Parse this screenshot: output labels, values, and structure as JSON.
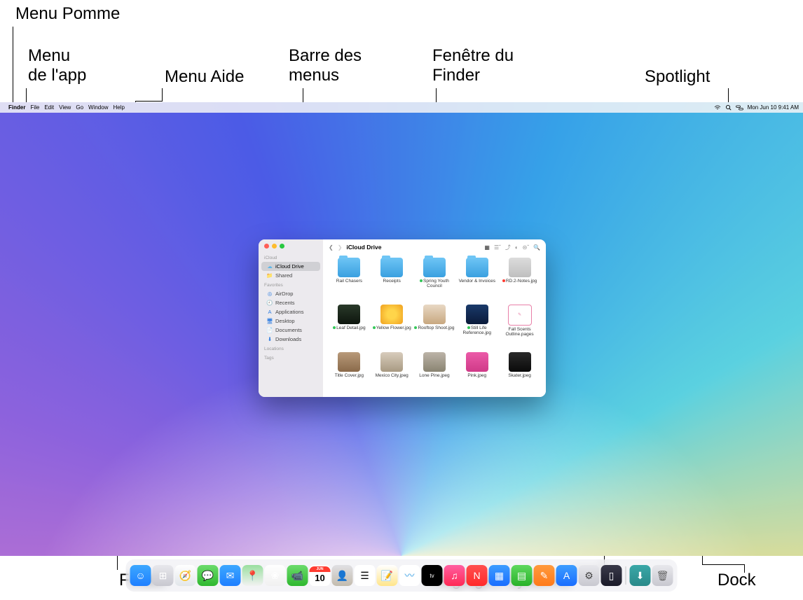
{
  "callouts": {
    "apple_menu": "Menu Pomme",
    "app_menu_1": "Menu",
    "app_menu_2": "de l'app",
    "help_menu": "Menu Aide",
    "menu_bar_1": "Barre des",
    "menu_bar_2": "menus",
    "finder_win_1": "Fenêtre du",
    "finder_win_2": "Finder",
    "spotlight": "Spotlight",
    "finder": "Finder",
    "system_settings": "Réglages Système",
    "dock": "Dock"
  },
  "menubar": {
    "items": [
      "Finder",
      "File",
      "Edit",
      "View",
      "Go",
      "Window",
      "Help"
    ],
    "status": {
      "wifi": "wifi",
      "spotlight": "search",
      "control": "control-center"
    },
    "clock": "Mon Jun 10  9:41 AM"
  },
  "finder": {
    "title": "iCloud Drive",
    "sidebar": {
      "sections": [
        {
          "label": "iCloud",
          "items": [
            {
              "icon": "cloud",
              "label": "iCloud Drive",
              "selected": true,
              "color": "#5cb6ea"
            },
            {
              "icon": "shared",
              "label": "Shared",
              "color": "#5cb6ea"
            }
          ]
        },
        {
          "label": "Favorites",
          "items": [
            {
              "icon": "airdrop",
              "label": "AirDrop",
              "color": "#2f7de0"
            },
            {
              "icon": "clock",
              "label": "Recents",
              "color": "#2f7de0"
            },
            {
              "icon": "apps",
              "label": "Applications",
              "color": "#2f7de0"
            },
            {
              "icon": "desktop",
              "label": "Desktop",
              "color": "#2f7de0"
            },
            {
              "icon": "doc",
              "label": "Documents",
              "color": "#2f7de0"
            },
            {
              "icon": "download",
              "label": "Downloads",
              "color": "#2f7de0"
            }
          ]
        },
        {
          "label": "Locations",
          "items": []
        },
        {
          "label": "Tags",
          "items": []
        }
      ]
    },
    "files": [
      {
        "name": "Rail Chasers",
        "type": "folder"
      },
      {
        "name": "Receipts",
        "type": "folder"
      },
      {
        "name": "Spring Youth Council",
        "type": "folder",
        "dot": "#34c759"
      },
      {
        "name": "Vendor & Invoices",
        "type": "folder"
      },
      {
        "name": "RD.2-Notes.jpg",
        "type": "img",
        "dot": "#ff3b30",
        "bg": "linear-gradient(#dcdcdc,#bfbfbf)"
      },
      {
        "name": "Leaf Detail.jpg",
        "type": "img",
        "dot": "#34c759",
        "bg": "linear-gradient(#2a3a2a,#0d150d)"
      },
      {
        "name": "Yellow Flower.jpg",
        "type": "img",
        "dot": "#34c759",
        "bg": "radial-gradient(circle,#ffd54a 30%,#f0a020)"
      },
      {
        "name": "Rooftop Shoot.jpg",
        "type": "img",
        "dot": "#34c759",
        "bg": "linear-gradient(#e8d8c4,#c8a880)"
      },
      {
        "name": "Still Life Reference.jpg",
        "type": "img",
        "dot": "#34c759",
        "bg": "linear-gradient(#1a3a6a,#0a1a3a)"
      },
      {
        "name": "Fall Scents Outline.pages",
        "type": "page"
      },
      {
        "name": "Title Cover.jpg",
        "type": "img",
        "bg": "linear-gradient(#b89a7a,#8a6a4a)"
      },
      {
        "name": "Mexico City.jpeg",
        "type": "img",
        "bg": "linear-gradient(#d8ccbc,#a89a82)"
      },
      {
        "name": "Lone Pine.jpeg",
        "type": "img",
        "bg": "linear-gradient(#bcb4a8,#8a8472)"
      },
      {
        "name": "Pink.jpeg",
        "type": "img",
        "bg": "linear-gradient(#ec5aa8,#d03a88)"
      },
      {
        "name": "Skater.jpeg",
        "type": "img",
        "bg": "linear-gradient(#2a2a2a,#0a0a0a)"
      }
    ]
  },
  "dock": [
    {
      "name": "finder",
      "bg": "linear-gradient(#3da8ff,#1f7fff)",
      "glyph": "☺"
    },
    {
      "name": "launchpad",
      "bg": "linear-gradient(#e8e8ec,#c8c8d0)",
      "glyph": "⊞"
    },
    {
      "name": "safari",
      "bg": "linear-gradient(#ffffff,#e2e6ea)",
      "glyph": "🧭"
    },
    {
      "name": "messages",
      "bg": "linear-gradient(#6bdb6b,#2fb82f)",
      "glyph": "💬"
    },
    {
      "name": "mail",
      "bg": "linear-gradient(#3da8ff,#1f7fff)",
      "glyph": "✉"
    },
    {
      "name": "maps",
      "bg": "linear-gradient(#9adfa0,#f2f2f2)",
      "glyph": "📍"
    },
    {
      "name": "photos",
      "bg": "linear-gradient(#ffffff,#f0f0f0)",
      "glyph": "❀"
    },
    {
      "name": "facetime",
      "bg": "linear-gradient(#6bdb6b,#2fb82f)",
      "glyph": "📹"
    },
    {
      "name": "calendar",
      "bg": "#ffffff",
      "glyph": "10",
      "textcolor": "#000",
      "top": "JUN"
    },
    {
      "name": "contacts",
      "bg": "linear-gradient(#e0e0e4,#c4bcae)",
      "glyph": "👤"
    },
    {
      "name": "reminders",
      "bg": "#ffffff",
      "glyph": "☰",
      "textcolor": "#000"
    },
    {
      "name": "notes",
      "bg": "linear-gradient(#fff,#ffe58a)",
      "glyph": "📝"
    },
    {
      "name": "freeform",
      "bg": "#ffffff",
      "glyph": "〰",
      "textcolor": "#3aa0e4"
    },
    {
      "name": "tv",
      "bg": "#000000",
      "glyph": "tv"
    },
    {
      "name": "music",
      "bg": "linear-gradient(#ff5fa2,#ff2a55)",
      "glyph": "♫"
    },
    {
      "name": "news",
      "bg": "linear-gradient(#ff5050,#ff2a2a)",
      "glyph": "N"
    },
    {
      "name": "keynote",
      "bg": "linear-gradient(#3d9dff,#1a6eff)",
      "glyph": "▦"
    },
    {
      "name": "numbers",
      "bg": "linear-gradient(#5ed85e,#29b229)",
      "glyph": "▤"
    },
    {
      "name": "pages",
      "bg": "linear-gradient(#ff9a3d,#ff7a1a)",
      "glyph": "✎"
    },
    {
      "name": "appstore",
      "bg": "linear-gradient(#3d9dff,#1a6eff)",
      "glyph": "A"
    },
    {
      "name": "settings",
      "bg": "linear-gradient(#e8e8ec,#c8c8d0)",
      "glyph": "⚙",
      "textcolor": "#444"
    },
    {
      "name": "iphone-mirroring",
      "bg": "linear-gradient(#3a3a4a,#1a1a28)",
      "glyph": "▯"
    },
    {
      "name": "sep"
    },
    {
      "name": "downloads",
      "bg": "linear-gradient(#3aa8a8,#2a8a8a)",
      "glyph": "⬇"
    },
    {
      "name": "trash",
      "bg": "linear-gradient(#e8e8ec,#c8c8d0)",
      "glyph": "🗑",
      "textcolor": "#666"
    }
  ]
}
